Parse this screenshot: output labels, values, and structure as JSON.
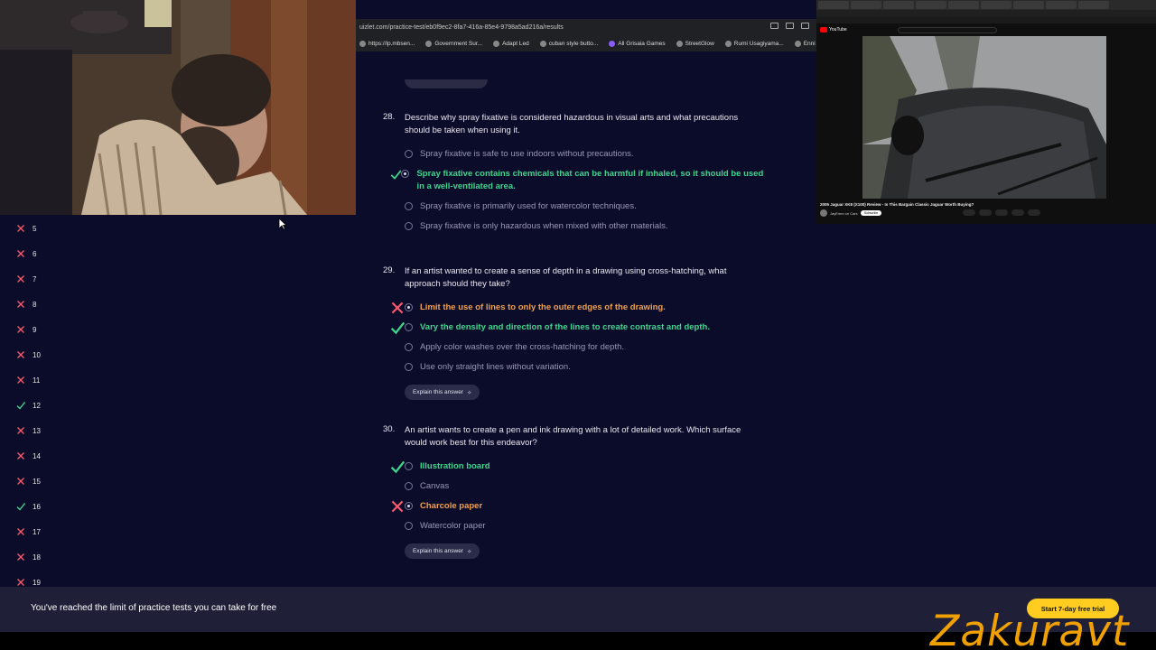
{
  "browser": {
    "url": "uizlet.com/practice-test/eb0f9ec2-8fa7-416a-85e4-9798a5ad216a/results",
    "bookmarks": [
      "https://lp.mbsen...",
      "Government Sur...",
      "Adapt Led",
      "cuban style butto...",
      "All Grisaia Games",
      "StreetGlow",
      "Rumi Usagiyama...",
      "Enni"
    ]
  },
  "sidebar": {
    "items": [
      {
        "num": "5",
        "status": "wrong"
      },
      {
        "num": "6",
        "status": "wrong"
      },
      {
        "num": "7",
        "status": "wrong"
      },
      {
        "num": "8",
        "status": "wrong"
      },
      {
        "num": "9",
        "status": "wrong"
      },
      {
        "num": "10",
        "status": "wrong"
      },
      {
        "num": "11",
        "status": "wrong"
      },
      {
        "num": "12",
        "status": "correct"
      },
      {
        "num": "13",
        "status": "wrong"
      },
      {
        "num": "14",
        "status": "wrong"
      },
      {
        "num": "15",
        "status": "wrong"
      },
      {
        "num": "16",
        "status": "correct"
      },
      {
        "num": "17",
        "status": "wrong"
      },
      {
        "num": "18",
        "status": "wrong"
      },
      {
        "num": "19",
        "status": "wrong"
      }
    ]
  },
  "questions": [
    {
      "number": "28.",
      "text": "Describe why spray fixative is considered hazardous in visual arts and what precautions should be taken when using it.",
      "options": [
        {
          "text": "Spray fixative is safe to use indoors without precautions.",
          "state": "neutral",
          "selected": false
        },
        {
          "text": "Spray fixative contains chemicals that can be harmful if inhaled, so it should be used in a well-ventilated area.",
          "state": "correct",
          "selected": true
        },
        {
          "text": "Spray fixative is primarily used for watercolor techniques.",
          "state": "neutral",
          "selected": false
        },
        {
          "text": "Spray fixative is only hazardous when mixed with other materials.",
          "state": "neutral",
          "selected": false
        }
      ]
    },
    {
      "number": "29.",
      "text": "If an artist wanted to create a sense of depth in a drawing using cross-hatching, what approach should they take?",
      "options": [
        {
          "text": "Limit the use of lines to only the outer edges of the drawing.",
          "state": "wrong",
          "selected": true
        },
        {
          "text": "Vary the density and direction of the lines to create contrast and depth.",
          "state": "correct",
          "selected": false
        },
        {
          "text": "Apply color washes over the cross-hatching for depth.",
          "state": "neutral",
          "selected": false
        },
        {
          "text": "Use only straight lines without variation.",
          "state": "neutral",
          "selected": false
        }
      ],
      "explain_label": "Explain this answer"
    },
    {
      "number": "30.",
      "text": "An artist wants to create a pen and ink drawing with a lot of detailed work. Which surface would work best for this endeavor?",
      "options": [
        {
          "text": "Illustration board",
          "state": "correct",
          "selected": false
        },
        {
          "text": "Canvas",
          "state": "neutral",
          "selected": false
        },
        {
          "text": "Charcole paper",
          "state": "wrong",
          "selected": true
        },
        {
          "text": "Watercolor paper",
          "state": "neutral",
          "selected": false
        }
      ],
      "explain_label": "Explain this answer"
    }
  ],
  "footer": {
    "message": "You've reached the limit of practice tests you can take for free",
    "trial_button": "Start 7-day free trial"
  },
  "youtube": {
    "logo": "YouTube",
    "video_title": "2005 Jaguar XK8 (X100) Review - Is This Bargain Classic Jaguar Worth Buying?",
    "channel": "JayEmm on Cars",
    "subscribe_label": "Subscribe"
  },
  "watermark": "Zakuravt",
  "colors": {
    "page_bg": "#0b0b2a",
    "correct": "#3ed68e",
    "wrong": "#f0a24a",
    "wrong_x": "#ff5a6e",
    "trial_button": "#ffcd1f",
    "watermark": "#f0a000"
  }
}
